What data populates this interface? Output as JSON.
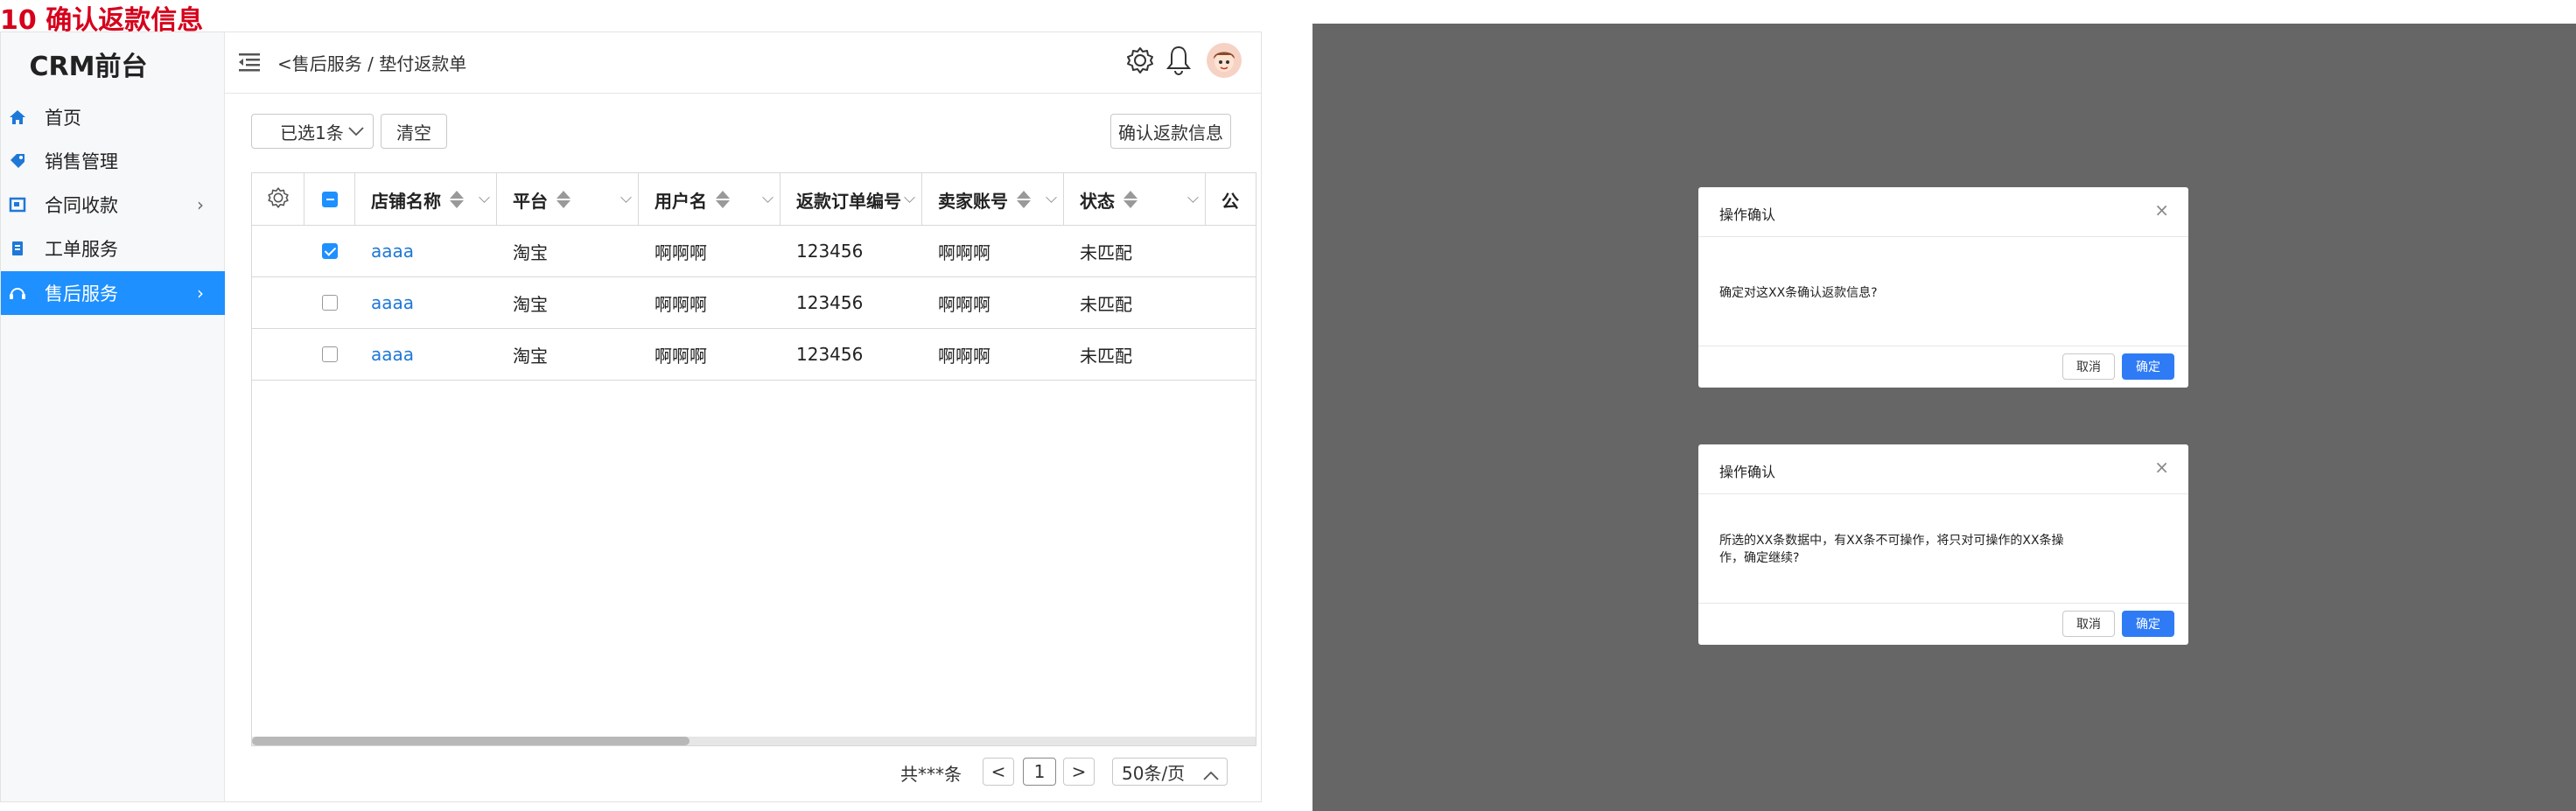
{
  "page_title": "10 确认返款信息",
  "app": {
    "brand": "CRM前台",
    "sidebar": [
      {
        "label": "首页",
        "icon": "home-icon"
      },
      {
        "label": "销售管理",
        "icon": "tag-icon"
      },
      {
        "label": "合同收款",
        "icon": "contract-icon",
        "has_chevron": true
      },
      {
        "label": "工单服务",
        "icon": "clipboard-icon"
      },
      {
        "label": "售后服务",
        "icon": "headset-icon",
        "has_chevron": true,
        "active": true
      }
    ],
    "breadcrumb": {
      "back": "<",
      "parent": "售后服务",
      "separator": "/",
      "current": "垫付返款单"
    },
    "toolbar": {
      "selected_label": "已选1条",
      "clear_label": "清空",
      "confirm_label": "确认返款信息"
    },
    "table": {
      "columns": [
        "店铺名称",
        "平台",
        "用户名",
        "返款订单编号",
        "卖家账号",
        "状态",
        "公"
      ],
      "rows": [
        {
          "checked": true,
          "shop": "aaaa",
          "platform": "淘宝",
          "user": "啊啊啊",
          "order": "123456",
          "seller": "啊啊啊",
          "status": "未匹配"
        },
        {
          "checked": false,
          "shop": "aaaa",
          "platform": "淘宝",
          "user": "啊啊啊",
          "order": "123456",
          "seller": "啊啊啊",
          "status": "未匹配"
        },
        {
          "checked": false,
          "shop": "aaaa",
          "platform": "淘宝",
          "user": "啊啊啊",
          "order": "123456",
          "seller": "啊啊啊",
          "status": "未匹配"
        }
      ]
    },
    "pagination": {
      "total": "共***条",
      "prev": "<",
      "page": "1",
      "next": ">",
      "page_size": "50条/页"
    }
  },
  "dialogs": [
    {
      "title": "操作确认",
      "close": "×",
      "message": "确定对这XX条确认返款信息?",
      "cancel": "取消",
      "ok": "确定"
    },
    {
      "title": "操作确认",
      "close": "×",
      "message_line1": "所选的XX条数据中，有XX条不可操作，将只对可操作的XX条操",
      "message_line2": "作，确定继续?",
      "cancel": "取消",
      "ok": "确定"
    }
  ],
  "colors": {
    "title_red": "#d6001c",
    "accent": "#1e90ff",
    "link": "#1e78d7",
    "overlay": "#666666",
    "primary_button": "#2f7bf5"
  }
}
